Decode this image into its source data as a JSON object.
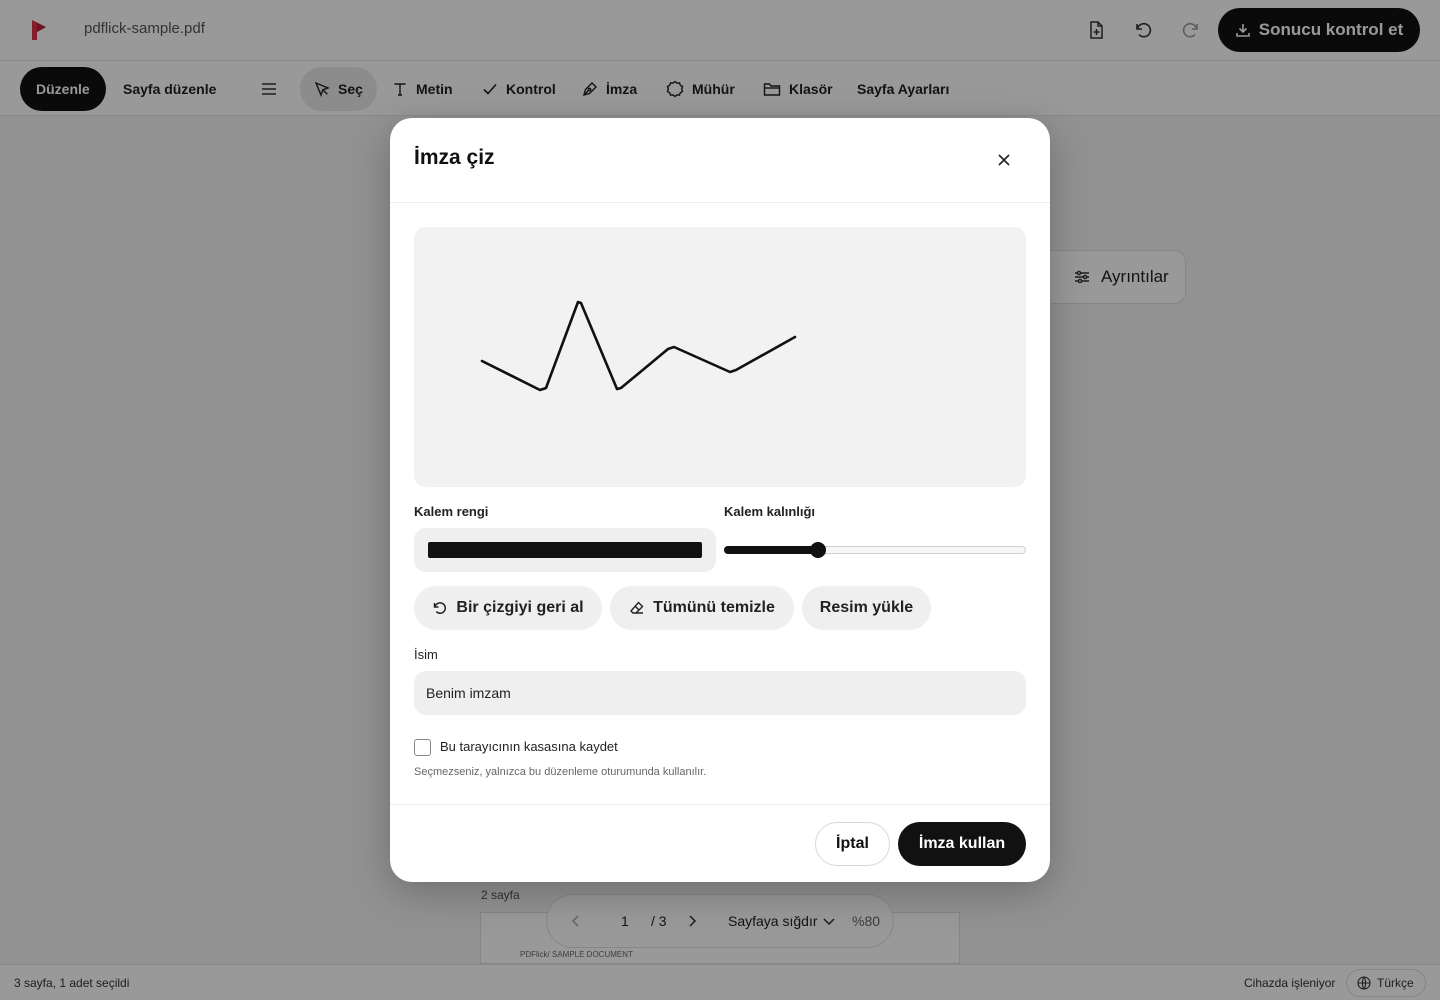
{
  "app": {
    "filename": "pdflick-sample.pdf",
    "brand_color": "#e0314b",
    "cta_label": "Sonucu kontrol et",
    "cta_icon": "download-icon",
    "top_icons": [
      "add-page-icon",
      "undo-icon",
      "redo-icon"
    ]
  },
  "toolbar": {
    "items": [
      {
        "label": "Düzenle",
        "icon": "",
        "state": "active"
      },
      {
        "label": "Sayfa düzenle",
        "icon": "",
        "state": "normal"
      },
      {
        "label": "",
        "icon": "menu-icon",
        "state": "normal"
      },
      {
        "label": "Seç",
        "icon": "cursor-icon",
        "state": "selected"
      },
      {
        "label": "Metin",
        "icon": "text-icon",
        "state": "normal"
      },
      {
        "label": "Kontrol",
        "icon": "check-icon",
        "state": "normal"
      },
      {
        "label": "İmza",
        "icon": "pen-icon",
        "state": "normal"
      },
      {
        "label": "Mühür",
        "icon": "seal-icon",
        "state": "normal"
      },
      {
        "label": "Klasör",
        "icon": "folder-icon",
        "state": "normal"
      },
      {
        "label": "Sayfa Ayarları",
        "icon": "",
        "state": "normal"
      }
    ]
  },
  "workspace": {
    "details_label": "Ayrıntılar",
    "page_count_label": "2 sayfa",
    "page_header": "PDFlick/ SAMPLE DOCUMENT",
    "pager": {
      "current_page": "1",
      "total": "/ 3",
      "fit_label": "Sayfaya sığdır",
      "zoom": "%80"
    }
  },
  "status": {
    "left": "3 sayfa, 1 adet seçildi",
    "device": "Cihazda işleniyor",
    "language": "Türkçe"
  },
  "modal": {
    "title": "İmza çiz",
    "pen_color_label": "Kalem rengi",
    "pen_color": "#111111",
    "pen_width_label": "Kalem kalınlığı",
    "pen_width_fraction": 0.31,
    "undo_stroke_label": "Bir çizgiyi geri al",
    "clear_all_label": "Tümünü temizle",
    "upload_image_label": "Resim yükle",
    "name_label": "İsim",
    "name_value": "Benim imzam",
    "save_checkbox_label": "Bu tarayıcının kasasına kaydet",
    "save_checked": false,
    "hint": "Seçmezseniz, yalnızca bu düzenleme oturumunda kullanılır.",
    "cancel_label": "İptal",
    "use_label": "İmza kullan"
  }
}
